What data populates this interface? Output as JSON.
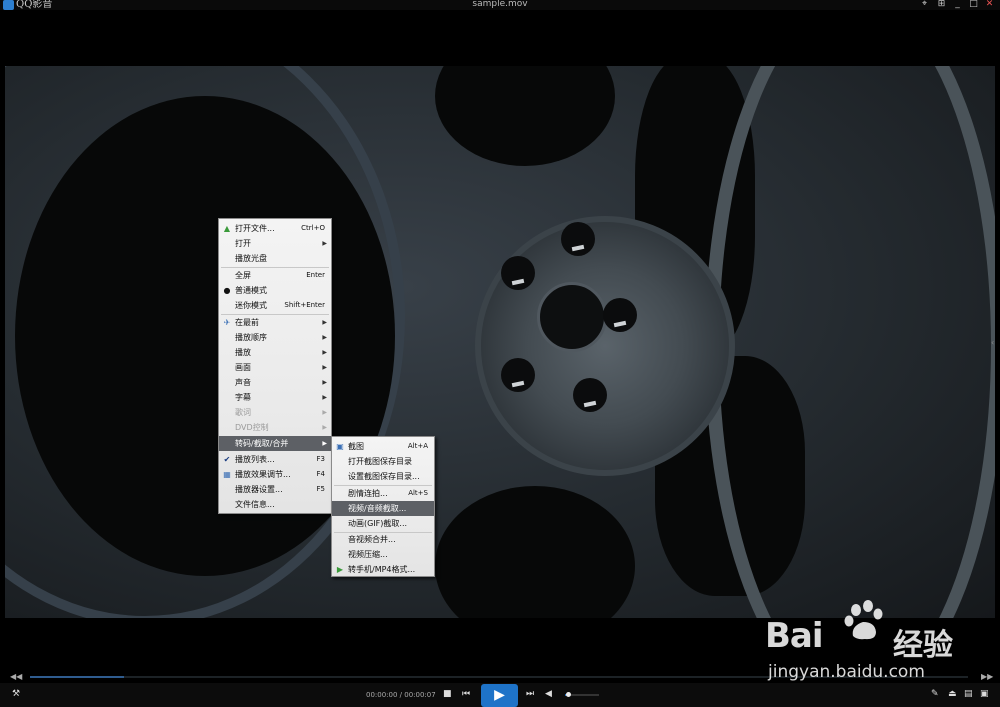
{
  "app": {
    "name": "QQ影音",
    "window_title": "sample.mov"
  },
  "window_buttons": [
    "⌖",
    "⊞",
    "_",
    "□",
    "✕"
  ],
  "seek": {
    "rewind": "◀◀",
    "forward": "▶▶",
    "progress": 0.1
  },
  "controls": {
    "time_text": "00:00:00 / 00:00:07",
    "stop": "■",
    "prev": "⏮",
    "play": "▶",
    "next": "⏭",
    "volume_icon": "◀",
    "volume_level": 0.1
  },
  "menu": {
    "items": [
      {
        "label": "打开文件...",
        "shortcut": "Ctrl+O",
        "icon": "open-file-icon"
      },
      {
        "label": "打开",
        "arrow": true
      },
      {
        "label": "播放光盘"
      },
      {
        "label": "全屏",
        "shortcut": "Enter"
      },
      {
        "label": "普通模式",
        "icon": "radio-dot-icon"
      },
      {
        "label": "迷你模式",
        "shortcut": "Shift+Enter"
      },
      {
        "label": "在最前",
        "arrow": true,
        "icon": "pin-icon"
      },
      {
        "label": "播放顺序",
        "arrow": true
      },
      {
        "label": "播放",
        "arrow": true
      },
      {
        "label": "画面",
        "arrow": true
      },
      {
        "label": "声音",
        "arrow": true
      },
      {
        "label": "字幕",
        "arrow": true
      },
      {
        "label": "歌词",
        "arrow": true,
        "disabled": true
      },
      {
        "label": "DVD控制",
        "arrow": true,
        "disabled": true
      },
      {
        "label": "转码/截取/合并",
        "arrow": true,
        "highlight": true
      },
      {
        "label": "播放列表...",
        "shortcut": "F3",
        "icon": "checkmark-icon"
      },
      {
        "label": "播放效果调节...",
        "shortcut": "F4",
        "icon": "effects-icon"
      },
      {
        "label": "播放器设置...",
        "shortcut": "F5"
      },
      {
        "label": "文件信息..."
      }
    ]
  },
  "submenu": {
    "items": [
      {
        "label": "截图",
        "shortcut": "Alt+A",
        "icon": "screenshot-icon"
      },
      {
        "label": "打开截图保存目录"
      },
      {
        "label": "设置截图保存目录..."
      },
      {
        "label": "剧情连拍...",
        "shortcut": "Alt+S"
      },
      {
        "label": "视频/音频截取...",
        "highlight": true
      },
      {
        "label": "动画(GIF)截取..."
      },
      {
        "label": "音视频合并..."
      },
      {
        "label": "视频压缩..."
      },
      {
        "label": "转手机/MP4格式...",
        "icon": "convert-icon"
      }
    ]
  },
  "watermark": {
    "brand": "Bai",
    "brand_suffix": "经验",
    "url": "jingyan.baidu.com"
  },
  "colors": {
    "accent": "#1e73c8",
    "highlight": "#5d6065"
  }
}
